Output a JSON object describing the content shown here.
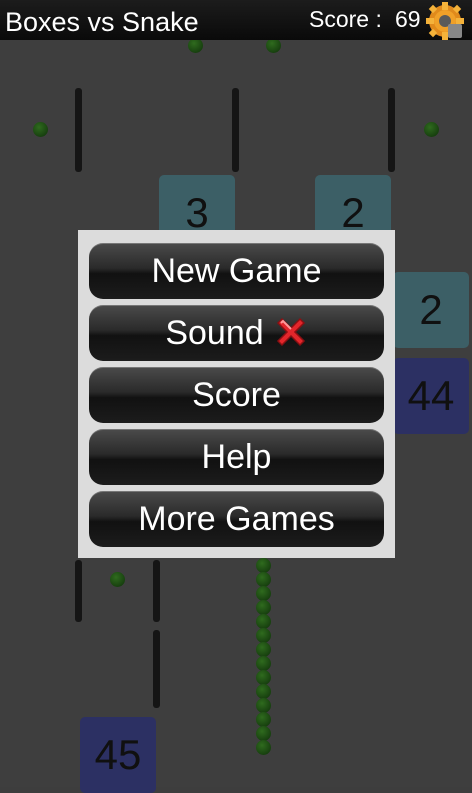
{
  "header": {
    "title": "Boxes vs Snake",
    "score_label": "Score :",
    "score_value": "69"
  },
  "icons": {
    "settings": "gear-icon",
    "sound_off": "red-x-icon"
  },
  "board": {
    "boxes": [
      {
        "label": "3",
        "color": "teal"
      },
      {
        "label": "2",
        "color": "teal"
      },
      {
        "label": "2",
        "color": "teal"
      },
      {
        "label": "44",
        "color": "navy"
      },
      {
        "label": "45",
        "color": "navy"
      }
    ]
  },
  "menu": {
    "items": [
      {
        "label": "New Game"
      },
      {
        "label": "Sound"
      },
      {
        "label": "Score"
      },
      {
        "label": "Help"
      },
      {
        "label": "More Games"
      }
    ]
  },
  "colors": {
    "teal_box": "#3c5f66",
    "navy_box": "#2c3063",
    "snake": "#2f6b1e",
    "menu_panel": "#dcdcdc"
  }
}
